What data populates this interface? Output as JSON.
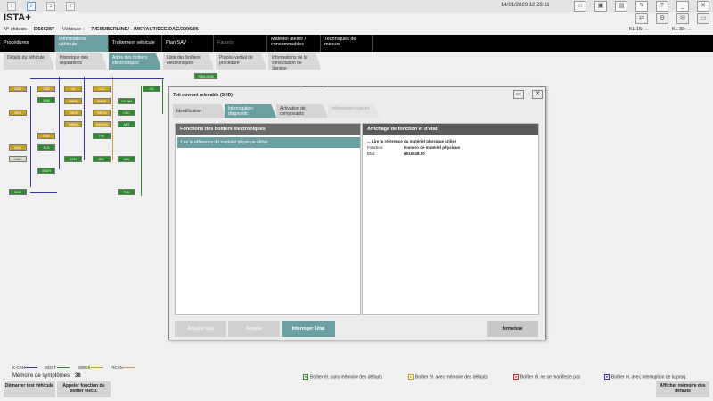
{
  "window_buttons": [
    "1",
    "2",
    "3"
  ],
  "datetime": "14/01/2023 12:28:11",
  "app_title": "ISTA+",
  "info": {
    "chassis_label": "N° châssis",
    "chassis_value": "DS66287",
    "vehicle_label": "Véhicule :",
    "vehicle_value": "7'/E65/BERLINE/ - /M67/AUT/ECE/DAG/2005/06",
    "kl15_label": "KL 15:",
    "kl15_value": "--",
    "kl30_label": "KL 30:",
    "kl30_value": "--"
  },
  "main_nav": [
    "Procédures",
    "Informations véhicule",
    "Traitement véhicule",
    "Plan SAV",
    "Favoris",
    "Matériel atelier / consommables",
    "Techniques de mesure"
  ],
  "sub_nav": [
    "Détails du véhicule",
    "Historique des réparations",
    "Arbre des boîtiers électroniques",
    "Liste des boîtiers électroniques",
    "Procès-verbal de procédure",
    "Informations de la consultation de Service"
  ],
  "diagram_nodes": {
    "col1": [
      "CON",
      "IHKA",
      "DWA",
      "SHD",
      "SINE"
    ],
    "col2": [
      "CSB",
      "WIM",
      "FDU",
      "RLS",
      "SHZH"
    ],
    "col3": [
      "LM",
      "SMFA",
      "TMFA",
      "TMBFA",
      "SZM"
    ],
    "col4": [
      "CAS",
      "SMBF",
      "TMFAh",
      "TMBFAh",
      "PM",
      "RDL"
    ],
    "col5": [
      "CD",
      "CD-WH",
      "CDC",
      "ANT",
      "NAV",
      "TCU"
    ],
    "col6": [
      "SGM-DGM"
    ]
  },
  "dialog": {
    "title": "Toit ouvrant relevable (SHD)",
    "tabs": [
      "Identification",
      "Interrogation diagnostic",
      "Activation de composants",
      "Information logicier"
    ],
    "left_header": "Fonctions des boîtiers électroniques",
    "left_item": "Lire la référence du matériel physique utilisé",
    "right_header": "Affichage de fonction et d'état",
    "right_line1": "... Lire la référence du matériel physique utilisé",
    "function_label": "Fonction:",
    "function_value": "Numéro de matériel physique",
    "state_label": "Etat:",
    "state_value": "6916048.00",
    "buttons": {
      "cancel_all": "Annuler tout",
      "cancel": "Annuler",
      "query_state": "Interroger l'état",
      "close": "fermeture"
    }
  },
  "legend": {
    "kcan": "K-CAN",
    "most": "MOST",
    "sibus": "SIBUS",
    "ptcan": "PtCAN"
  },
  "symptoms": {
    "label": "Mémoire de symptômes",
    "value": "36"
  },
  "status_legend": [
    "Boîtier él. sans mémoire des défauts",
    "Boîtier él. avec mémoire des défauts",
    "Boîtier él. ne se manifeste pas",
    "Boîtier él. avec interruption de la prog."
  ],
  "bottom_buttons": {
    "start_test": "Démarrer test véhicule",
    "call_function": "Appeler fonction du boîtier électr.",
    "show_memory": "Afficher mémoire des défauts"
  },
  "colors": {
    "accent": "#6b9fa2",
    "yellow_node": "#c8a020",
    "green_node": "#2d8a2d",
    "kcan_line": "#3a3aa8",
    "most_line": "#2d8a2d",
    "sibus_line": "#c8a020",
    "ptcan_line": "#d8a040"
  }
}
